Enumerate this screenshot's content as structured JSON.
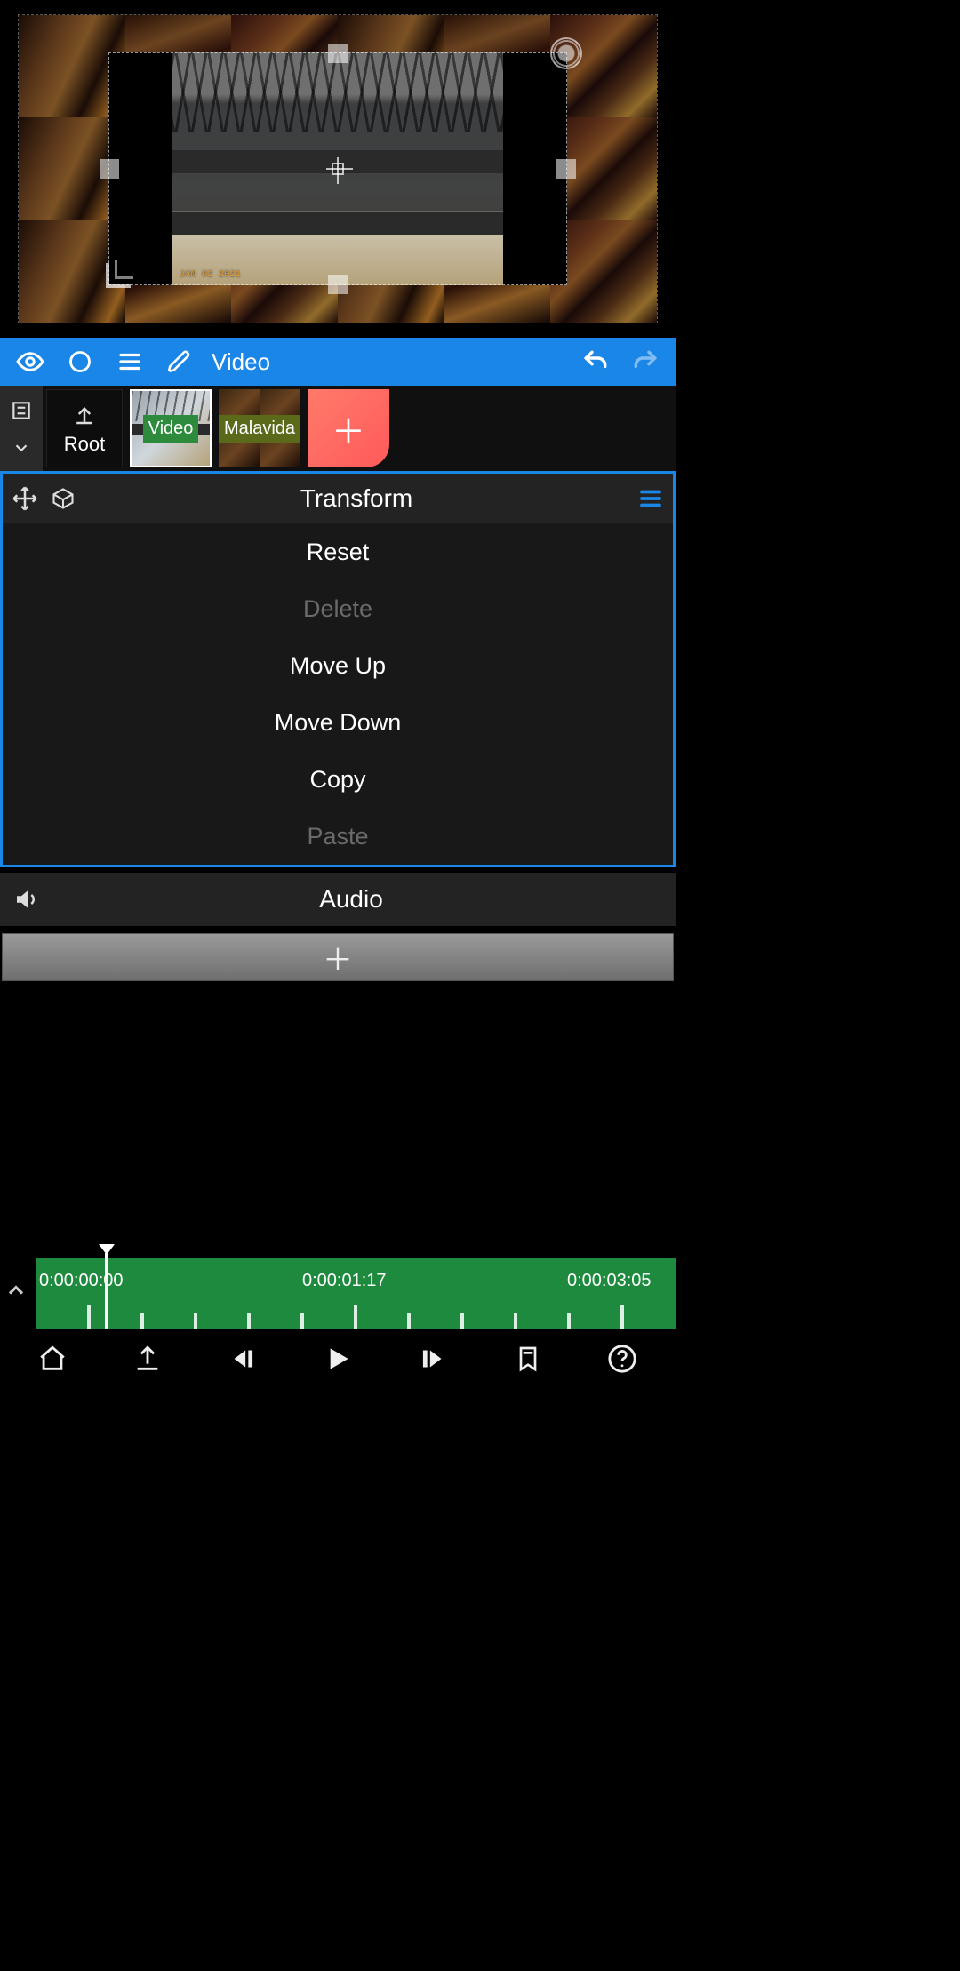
{
  "preview": {
    "clip_date": "JAN 02 2021"
  },
  "toolbar": {
    "mode_label": "Video"
  },
  "layers": {
    "root_label": "Root",
    "items": [
      {
        "label": "Video"
      },
      {
        "label": "Malavida"
      }
    ]
  },
  "transform_panel": {
    "title": "Transform",
    "items": [
      {
        "label": "Reset",
        "enabled": true
      },
      {
        "label": "Delete",
        "enabled": false
      },
      {
        "label": "Move Up",
        "enabled": true
      },
      {
        "label": "Move Down",
        "enabled": true
      },
      {
        "label": "Copy",
        "enabled": true
      },
      {
        "label": "Paste",
        "enabled": false
      }
    ]
  },
  "audio_row": {
    "title": "Audio"
  },
  "timeline": {
    "times": [
      "0:00:00:00",
      "0:00:01:17",
      "0:00:03:05"
    ]
  }
}
